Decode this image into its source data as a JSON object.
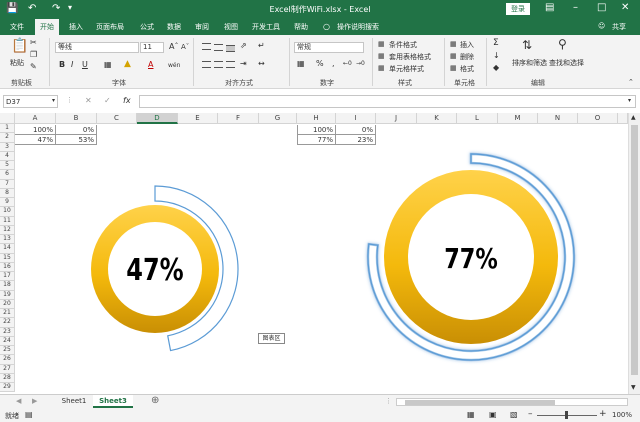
{
  "window": {
    "title": "Excel制作WiFi.xlsx  -  Excel",
    "login": "登录",
    "share": "共享"
  },
  "tabs": [
    "文件",
    "开始",
    "插入",
    "页面布局",
    "公式",
    "数据",
    "审阅",
    "视图",
    "开发工具",
    "帮助"
  ],
  "active_tab": "开始",
  "search_tell": "操作说明搜索",
  "ribbon": {
    "clipboard": {
      "paste": "粘贴",
      "group": "剪贴板"
    },
    "font": {
      "name": "等线",
      "size": "11",
      "group": "字体",
      "wen": "wén"
    },
    "align": {
      "group": "对齐方式"
    },
    "number": {
      "format": "常规",
      "group": "数字"
    },
    "styles": {
      "cond": "条件格式",
      "table": "套用表格格式",
      "cell": "单元格样式",
      "group": "样式"
    },
    "cells": {
      "insert": "插入",
      "delete": "删除",
      "format": "格式",
      "group": "单元格"
    },
    "edit": {
      "sort": "排序和筛选",
      "find": "查找和选择",
      "group": "编辑"
    }
  },
  "formula_bar": {
    "name_box": "D37",
    "fx": "fx"
  },
  "columns": [
    "A",
    "B",
    "C",
    "D",
    "E",
    "F",
    "G",
    "H",
    "I",
    "J",
    "K",
    "L",
    "M",
    "N",
    "O"
  ],
  "rows": [
    "1",
    "2",
    "3",
    "4",
    "5",
    "6",
    "7",
    "8",
    "9",
    "10",
    "11",
    "12",
    "13",
    "14",
    "15",
    "16",
    "17",
    "18",
    "19",
    "20",
    "21",
    "22",
    "23",
    "24",
    "25",
    "26",
    "27",
    "28",
    "29"
  ],
  "cells": {
    "A1": "100%",
    "B1": "0%",
    "A2": "47%",
    "B2": "53%",
    "H1": "100%",
    "I1": "0%",
    "H2": "77%",
    "I2": "23%"
  },
  "charts": [
    {
      "label": "47%",
      "value": 0.47
    },
    {
      "label": "77%",
      "value": 0.77
    }
  ],
  "chart_tooltip": "图表区",
  "sheets": [
    "Sheet1",
    "Sheet3"
  ],
  "active_sheet": "Sheet3",
  "status": {
    "ready": "就绪",
    "zoom": "100%"
  },
  "colors": {
    "excel_green": "#217346",
    "gold_light": "#ffd24a",
    "gold_dark": "#c98f04",
    "ring_blue": "#5b9bd5"
  }
}
